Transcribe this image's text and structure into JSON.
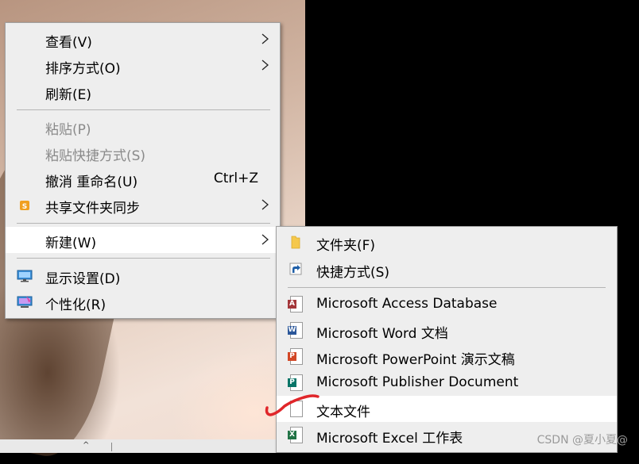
{
  "context_menu": {
    "items": [
      {
        "label": "查看(V)"
      },
      {
        "label": "排序方式(O)"
      },
      {
        "label": "刷新(E)"
      },
      {
        "label": "粘贴(P)"
      },
      {
        "label": "粘贴快捷方式(S)"
      },
      {
        "label": "撤消 重命名(U)",
        "shortcut": "Ctrl+Z"
      },
      {
        "label": "共享文件夹同步"
      },
      {
        "label": "新建(W)"
      },
      {
        "label": "显示设置(D)"
      },
      {
        "label": "个性化(R)"
      }
    ]
  },
  "new_submenu": {
    "items": [
      {
        "label": "文件夹(F)",
        "icon": "folder-icon"
      },
      {
        "label": "快捷方式(S)",
        "icon": "shortcut-icon"
      },
      {
        "label": "Microsoft Access Database",
        "icon": "access-icon",
        "color": "#a4373a",
        "badge": "A"
      },
      {
        "label": "Microsoft Word 文档",
        "icon": "word-icon",
        "color": "#2b579a",
        "badge": "W"
      },
      {
        "label": "Microsoft PowerPoint 演示文稿",
        "icon": "powerpoint-icon",
        "color": "#d24726",
        "badge": "P"
      },
      {
        "label": "Microsoft Publisher Document",
        "icon": "publisher-icon",
        "color": "#077568",
        "badge": "P"
      },
      {
        "label": "文本文件",
        "icon": "text-file-icon"
      },
      {
        "label": "Microsoft Excel 工作表",
        "icon": "excel-icon",
        "color": "#217346",
        "badge": "X"
      }
    ]
  },
  "watermark": "CSDN @夏小夏@",
  "colors": {
    "menu_bg": "#eeeeee",
    "highlight": "#ffffff",
    "disabled_text": "#8a8a8a",
    "annotation_red": "#e0262a"
  }
}
